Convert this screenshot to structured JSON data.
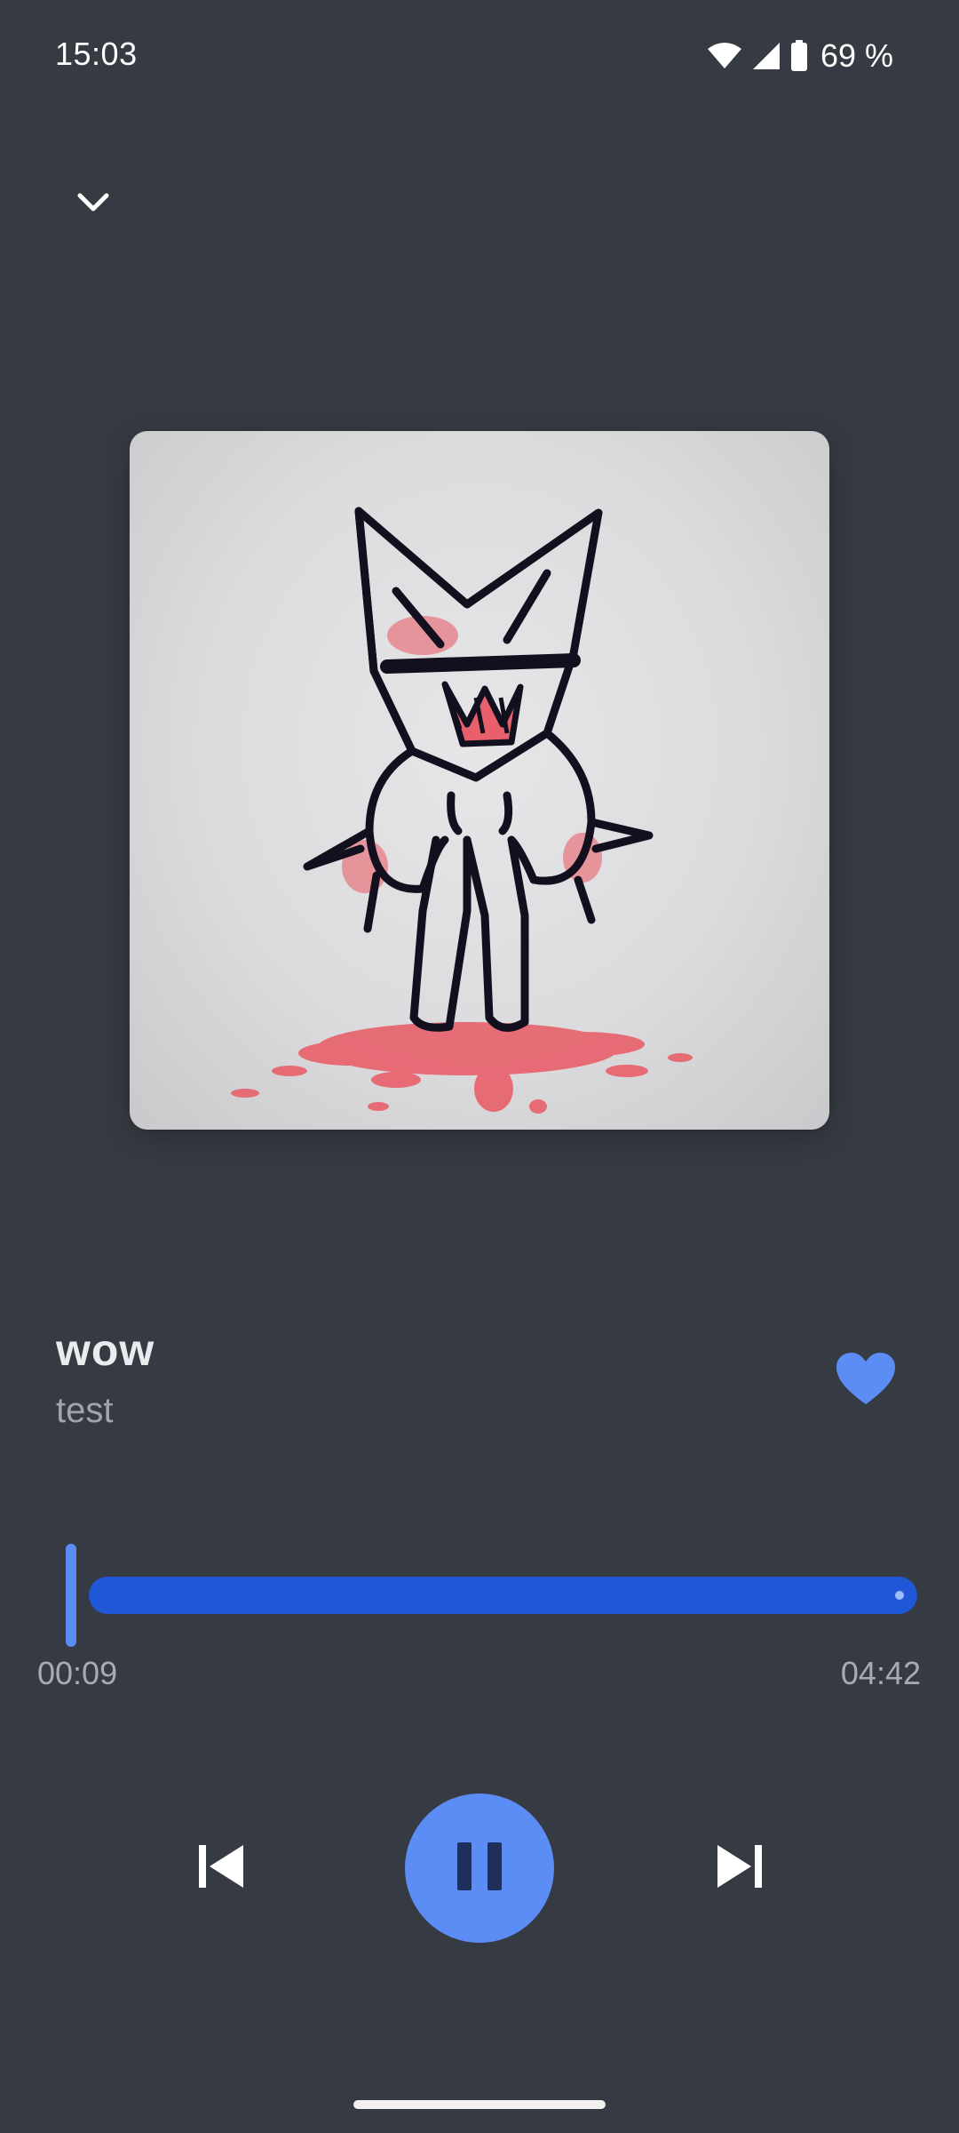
{
  "status_bar": {
    "time": "15:03",
    "battery_percent": "69 %",
    "icons": [
      "wifi-icon",
      "cell-signal-icon",
      "battery-icon"
    ]
  },
  "navigation": {
    "collapse_icon": "chevron-down-icon"
  },
  "track": {
    "title": "wow",
    "artist": "test",
    "favorited": true
  },
  "progress": {
    "elapsed": "00:09",
    "total": "04:42",
    "fraction": 0.032
  },
  "controls": {
    "previous_icon": "skip-previous-icon",
    "play_pause_icon": "pause-icon",
    "next_icon": "skip-next-icon",
    "state": "playing"
  },
  "colors": {
    "background": "#363a42",
    "accent": "#5b8df5",
    "seek_track": "#1f57d6",
    "secondary_text": "#a0a4ab"
  }
}
